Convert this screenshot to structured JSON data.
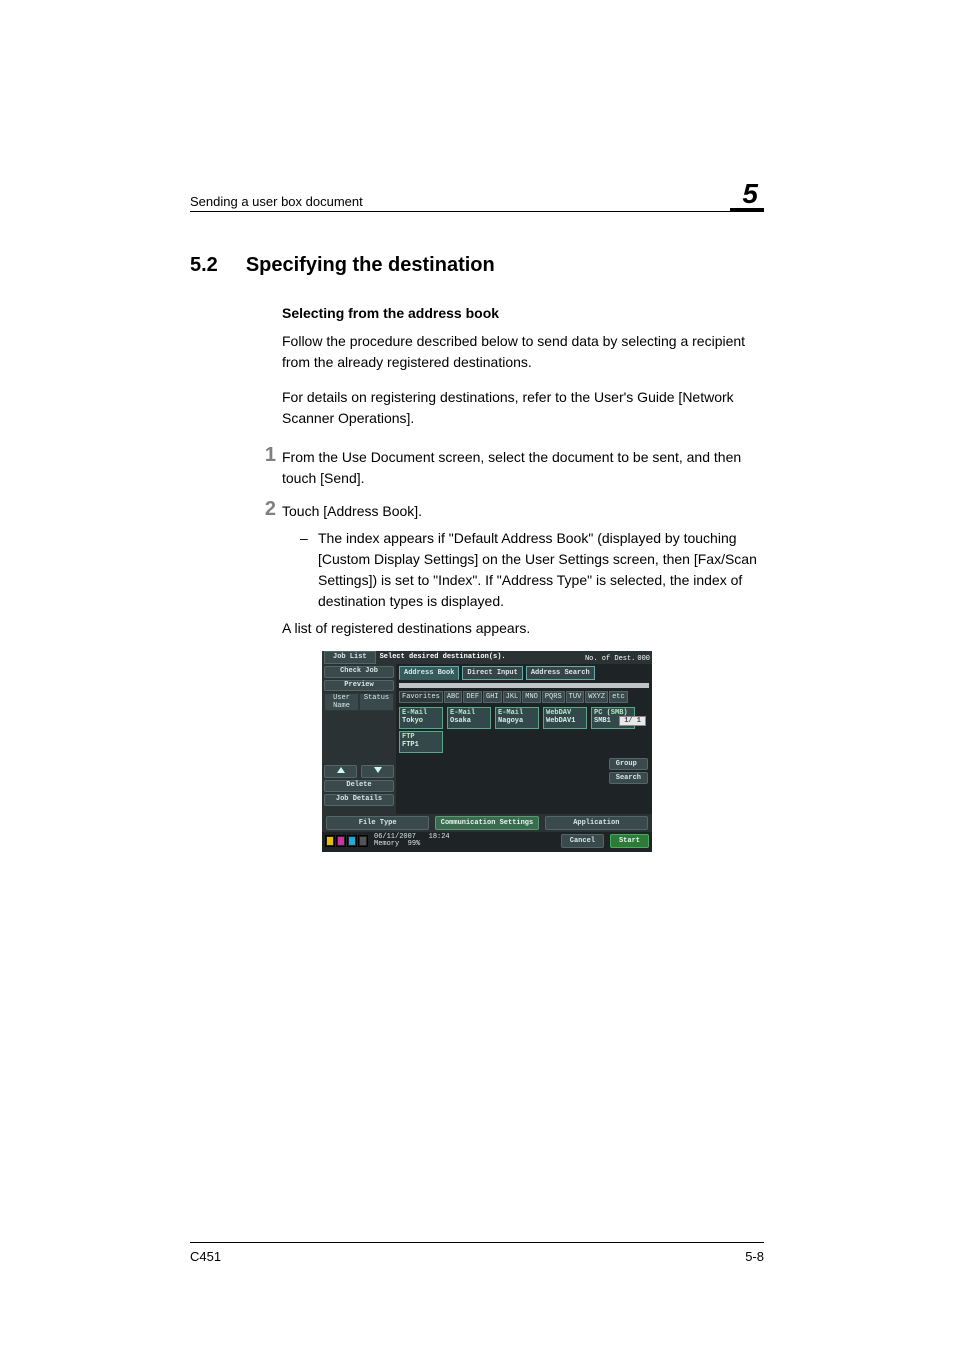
{
  "header": {
    "left": "Sending a user box document",
    "chapter_number": "5"
  },
  "section": {
    "number": "5.2",
    "title": "Specifying the destination"
  },
  "subsection_title": "Selecting from the address book",
  "paragraphs": {
    "p1": "Follow the procedure described below to send data by selecting a recipient from the already registered destinations.",
    "p2": "For details on registering destinations, refer to the User's Guide [Network Scanner Operations]."
  },
  "steps": [
    {
      "body": "From the Use Document screen, select the document to be sent, and then touch [Send]."
    },
    {
      "body": "Touch [Address Book].",
      "sub": [
        "The index appears if \"Default Address Book\" (displayed by touching [Custom Display Settings] on the User Settings screen, then [Fax/Scan Settings]) is set to \"Index\". If \"Address Type\" is selected, the index of destination types is displayed."
      ],
      "trail": "A list of registered destinations appears."
    }
  ],
  "panel": {
    "top_message": "Select desired destination(s).",
    "dest_label": "No. of Dest.",
    "dest_count": "000",
    "left": {
      "job_list": "Job List",
      "check_job": "Check Job",
      "preview": "Preview",
      "meta_left": "User Name",
      "meta_right": "Status",
      "delete": "Delete",
      "job_details": "Job Details"
    },
    "subtabs": {
      "address_book": "Address Book",
      "direct_input": "Direct Input",
      "address_search": "Address Search"
    },
    "index": [
      "Favorites",
      "ABC",
      "DEF",
      "GHI",
      "JKL",
      "MNO",
      "PQRS",
      "TUV",
      "WXYZ",
      "etc"
    ],
    "destinations": [
      {
        "type": "E-Mail",
        "name": "Tokyo"
      },
      {
        "type": "E-Mail",
        "name": "Osaka"
      },
      {
        "type": "E-Mail",
        "name": "Nagoya"
      },
      {
        "type": "WebDAV",
        "name": "WebDAV1"
      },
      {
        "type": "PC (SMB)",
        "name": "SMB1"
      },
      {
        "type": "FTP",
        "name": "FTP1"
      }
    ],
    "pager": "1/ 1",
    "side_buttons": {
      "group": "Group",
      "search": "Search"
    },
    "bottom_tabs": {
      "file_type": "File Type",
      "communication": "Communication Settings",
      "application": "Application"
    },
    "footer": {
      "date": "06/11/2007",
      "time": "18:24",
      "memory_label": "Memory",
      "memory_value": "99%",
      "cancel": "Cancel",
      "start": "Start"
    },
    "toner_labels": [
      "Y",
      "M",
      "C",
      "K"
    ]
  },
  "page_footer": {
    "left": "C451",
    "right": "5-8"
  }
}
